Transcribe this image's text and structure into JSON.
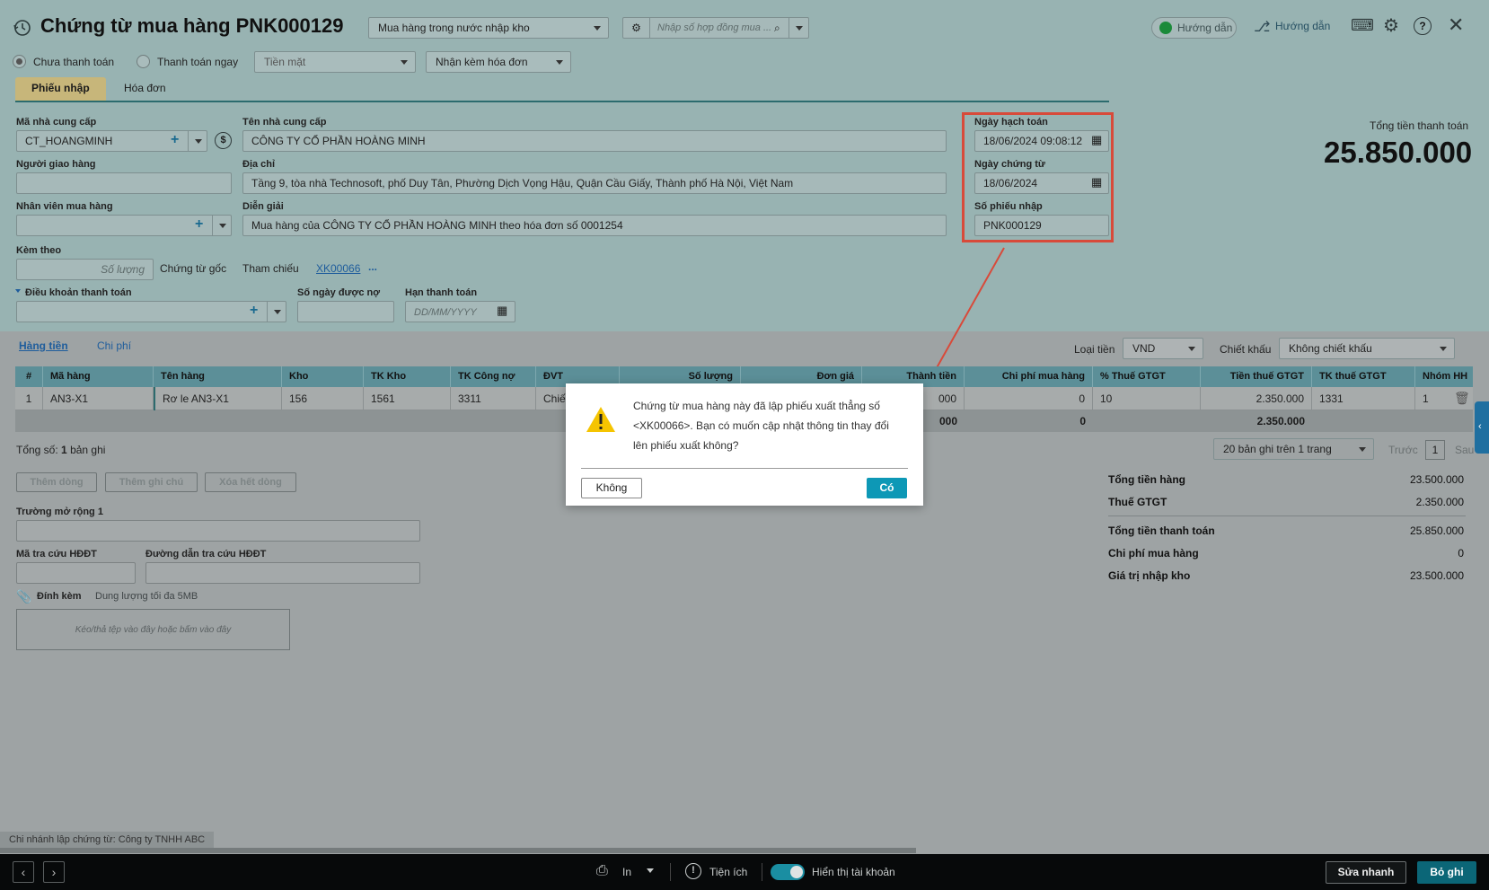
{
  "header": {
    "title": "Chứng từ mua hàng PNK000129",
    "purchase_type": "Mua hàng trong nước nhập kho",
    "contract_placeholder": "Nhập số hợp đồng mua ...",
    "guide_btn1": "Hướng dẫn",
    "guide_btn2": "Hướng dẫn"
  },
  "payment": {
    "unpaid": "Chưa thanh toán",
    "pay_now": "Thanh toán ngay",
    "method": "Tiền mặt",
    "invoice_option": "Nhận kèm hóa đơn"
  },
  "tabs": [
    "Phiếu nhập",
    "Hóa đơn"
  ],
  "form": {
    "supplier_code_label": "Mã nhà cung cấp",
    "supplier_code": "CT_HOANGMINH",
    "supplier_name_label": "Tên nhà cung cấp",
    "supplier_name": "CÔNG TY CỔ PHẦN HOÀNG MINH",
    "deliverer_label": "Người giao hàng",
    "address_label": "Địa chỉ",
    "address": "Tầng 9, tòa nhà Technosoft, phố Duy Tân, Phường Dịch Vọng Hậu, Quận Cầu Giấy, Thành phố Hà Nội, Việt Nam",
    "buyer_label": "Nhân viên mua hàng",
    "desc_label": "Diễn giải",
    "desc": "Mua hàng của CÔNG TY CỔ PHẦN HOÀNG MINH theo hóa đơn số 0001254",
    "attach_label": "Kèm theo",
    "qty_placeholder": "Số lượng",
    "orig_doc": "Chứng từ gốc",
    "ref_label": "Tham chiếu",
    "ref_link": "XK00066",
    "ref_more": "...",
    "terms_label": "Điều khoản thanh toán",
    "days_label": "Số ngày được nợ",
    "due_label": "Hạn thanh toán",
    "due_placeholder": "DD/MM/YYYY"
  },
  "dates": {
    "posting_label": "Ngày hạch toán",
    "posting": "18/06/2024 09:08:12",
    "doc_date_label": "Ngày chứng từ",
    "doc_date": "18/06/2024",
    "receipt_no_label": "Số phiếu nhập",
    "receipt_no": "PNK000129"
  },
  "total": {
    "label": "Tổng tiền thanh toán",
    "value": "25.850.000"
  },
  "detail_tabs": [
    "Hàng tiền",
    "Chi phí"
  ],
  "currency_label": "Loại tiền",
  "currency": "VND",
  "discount_label": "Chiết khấu",
  "discount": "Không chiết khấu",
  "grid": {
    "headers": [
      "#",
      "Mã hàng",
      "Tên hàng",
      "Kho",
      "TK Kho",
      "TK Công nợ",
      "ĐVT",
      "Số lượng",
      "Đơn giá",
      "Thành tiền",
      "Chi phí mua hàng",
      "% Thuế GTGT",
      "Tiền thuế GTGT",
      "TK thuế GTGT",
      "Nhóm HH"
    ],
    "row": [
      "1",
      "AN3-X1",
      "Rơ le AN3-X1",
      "156",
      "1561",
      "3311",
      "Chiế",
      "",
      "",
      "000",
      "0",
      "10",
      "2.350.000",
      "1331",
      "1"
    ],
    "sum": {
      "amount": "000",
      "cost": "0",
      "vat": "2.350.000"
    }
  },
  "records": {
    "prefix": "Tổng số:",
    "count": "1",
    "suffix": "bản ghi"
  },
  "pager": {
    "size": "20 bản ghi trên 1 trang",
    "prev": "Trước",
    "page": "1",
    "next": "Sau"
  },
  "grid_buttons": [
    "Thêm dòng",
    "Thêm ghi chú",
    "Xóa hết dòng"
  ],
  "ext": {
    "field1": "Trường mở rộng 1",
    "lookup_code": "Mã tra cứu HĐĐT",
    "lookup_url": "Đường dẫn tra cứu HĐĐT",
    "attach": "Đính kèm",
    "attach_limit": "Dung lượng tối đa 5MB",
    "drop": "Kéo/thả tệp vào đây hoặc bấm vào đây"
  },
  "summary": [
    {
      "k": "Tổng tiền hàng",
      "v": "23.500.000"
    },
    {
      "k": "Thuế GTGT",
      "v": "2.350.000"
    },
    {
      "k": "Tổng tiền thanh toán",
      "v": "25.850.000"
    },
    {
      "k": "Chi phí mua hàng",
      "v": "0"
    },
    {
      "k": "Giá trị nhập kho",
      "v": "23.500.000"
    }
  ],
  "dialog": {
    "message": "Chứng từ mua hàng này đã lập phiếu xuất thẳng số <XK00066>. Bạn có muốn cập nhật thông tin thay đổi lên phiếu xuất không?",
    "no": "Không",
    "yes": "Có"
  },
  "branch": "Chi nhánh lập chứng từ: Công ty TNHH ABC",
  "footer": {
    "print": "In",
    "utilities": "Tiện ích",
    "show_accounts": "Hiển thị tài khoản",
    "quick_edit": "Sửa nhanh",
    "discard": "Bỏ ghi"
  }
}
